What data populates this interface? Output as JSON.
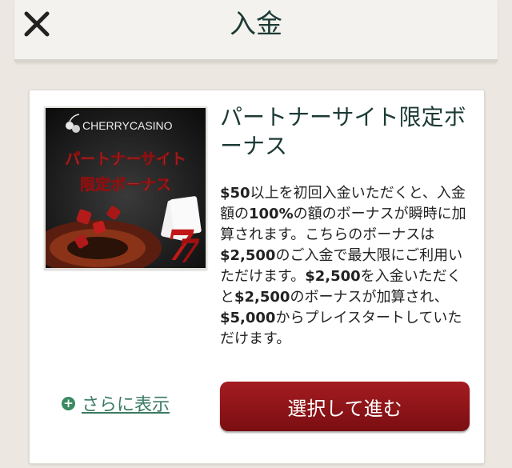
{
  "header": {
    "title": "入金",
    "close_icon": "close-icon"
  },
  "offer": {
    "banner": {
      "brand": "CHERRYCASINO",
      "line1": "パートナーサイト",
      "line2": "限定ボーナス",
      "logo_icon": "cherry-logo-icon"
    },
    "title": "パートナーサイト限定ボーナス",
    "description": {
      "p1a": "$50",
      "p1b": "以上を初回入金いただくと、入金額の",
      "p1c": "100%",
      "p1d": "の額のボーナスが瞬時に加算されます。こちらのボーナスは",
      "p1e": "$2,500",
      "p1f": "のご入金で最大限にご利用いただけます。",
      "p1g": "$2,500",
      "p1h": "を入金いただくと",
      "p1i": "$2,500",
      "p1j": "のボーナスが加算され、",
      "p1k": "$5,000",
      "p1l": "からプレイスタートしていただけます。"
    },
    "more_label": "さらに表示",
    "select_label": "選択して進む"
  },
  "colors": {
    "background": "#ece8e1",
    "title_text": "#1c3a35",
    "button": "#961519",
    "link": "#3b7a62"
  }
}
